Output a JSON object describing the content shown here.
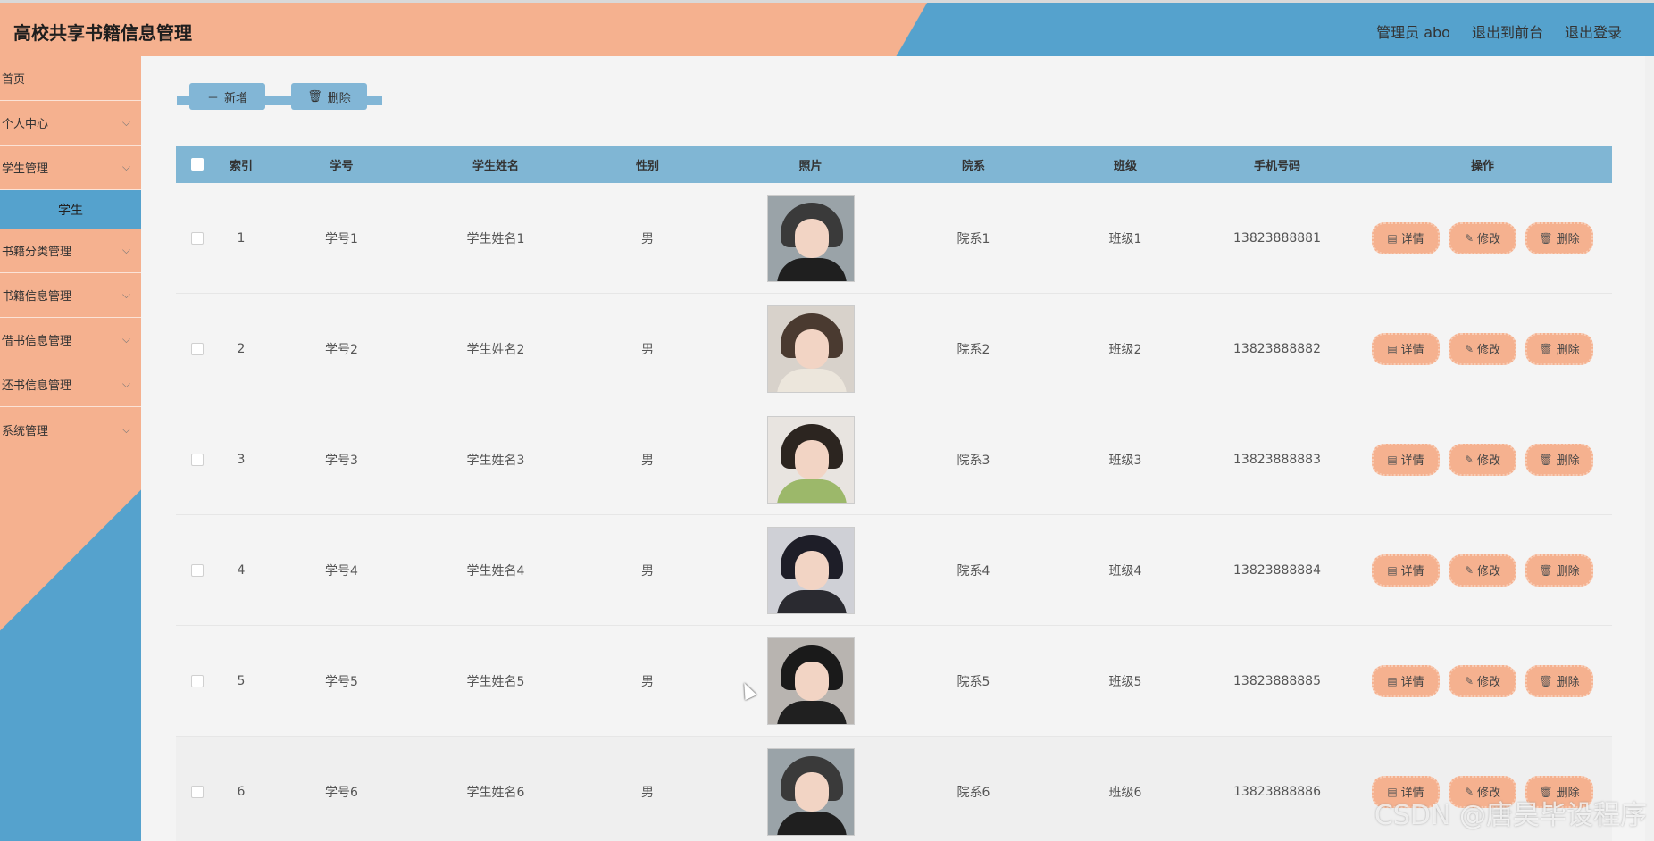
{
  "header": {
    "title": "高校共享书籍信息管理",
    "user": "管理员 abo",
    "to_front": "退出到前台",
    "logout": "退出登录"
  },
  "sidebar": {
    "items": [
      {
        "label": "首页",
        "chevron": false
      },
      {
        "label": "个人中心",
        "chevron": true
      },
      {
        "label": "学生管理",
        "chevron": true
      },
      {
        "label": "书籍分类管理",
        "chevron": true
      },
      {
        "label": "书籍信息管理",
        "chevron": true
      },
      {
        "label": "借书信息管理",
        "chevron": true
      },
      {
        "label": "还书信息管理",
        "chevron": true
      },
      {
        "label": "系统管理",
        "chevron": true
      }
    ],
    "subitem": "学生"
  },
  "toolbar": {
    "add_label": "新增",
    "delete_label": "删除",
    "add_icon": "plus-icon",
    "delete_icon": "trash-icon"
  },
  "table": {
    "headers": [
      "索引",
      "学号",
      "学生姓名",
      "性别",
      "照片",
      "院系",
      "班级",
      "手机号码",
      "操作"
    ],
    "rows": [
      {
        "idx": "1",
        "no": "学号1",
        "name": "学生姓名1",
        "sex": "男",
        "dept": "院系1",
        "class": "班级1",
        "phone": "13823888881"
      },
      {
        "idx": "2",
        "no": "学号2",
        "name": "学生姓名2",
        "sex": "男",
        "dept": "院系2",
        "class": "班级2",
        "phone": "13823888882"
      },
      {
        "idx": "3",
        "no": "学号3",
        "name": "学生姓名3",
        "sex": "男",
        "dept": "院系3",
        "class": "班级3",
        "phone": "13823888883"
      },
      {
        "idx": "4",
        "no": "学号4",
        "name": "学生姓名4",
        "sex": "男",
        "dept": "院系4",
        "class": "班级4",
        "phone": "13823888884"
      },
      {
        "idx": "5",
        "no": "学号5",
        "name": "学生姓名5",
        "sex": "男",
        "dept": "院系5",
        "class": "班级5",
        "phone": "13823888885"
      },
      {
        "idx": "6",
        "no": "学号6",
        "name": "学生姓名6",
        "sex": "男",
        "dept": "院系6",
        "class": "班级6",
        "phone": "13823888886"
      }
    ],
    "ops": {
      "detail": "详情",
      "edit": "修改",
      "delete": "删除"
    }
  },
  "colors": {
    "accent_orange": "#f5b18f",
    "accent_blue": "#55a2cd",
    "header_blue": "#80b6d4"
  },
  "watermark": "CSDN @唐昊毕设程序"
}
